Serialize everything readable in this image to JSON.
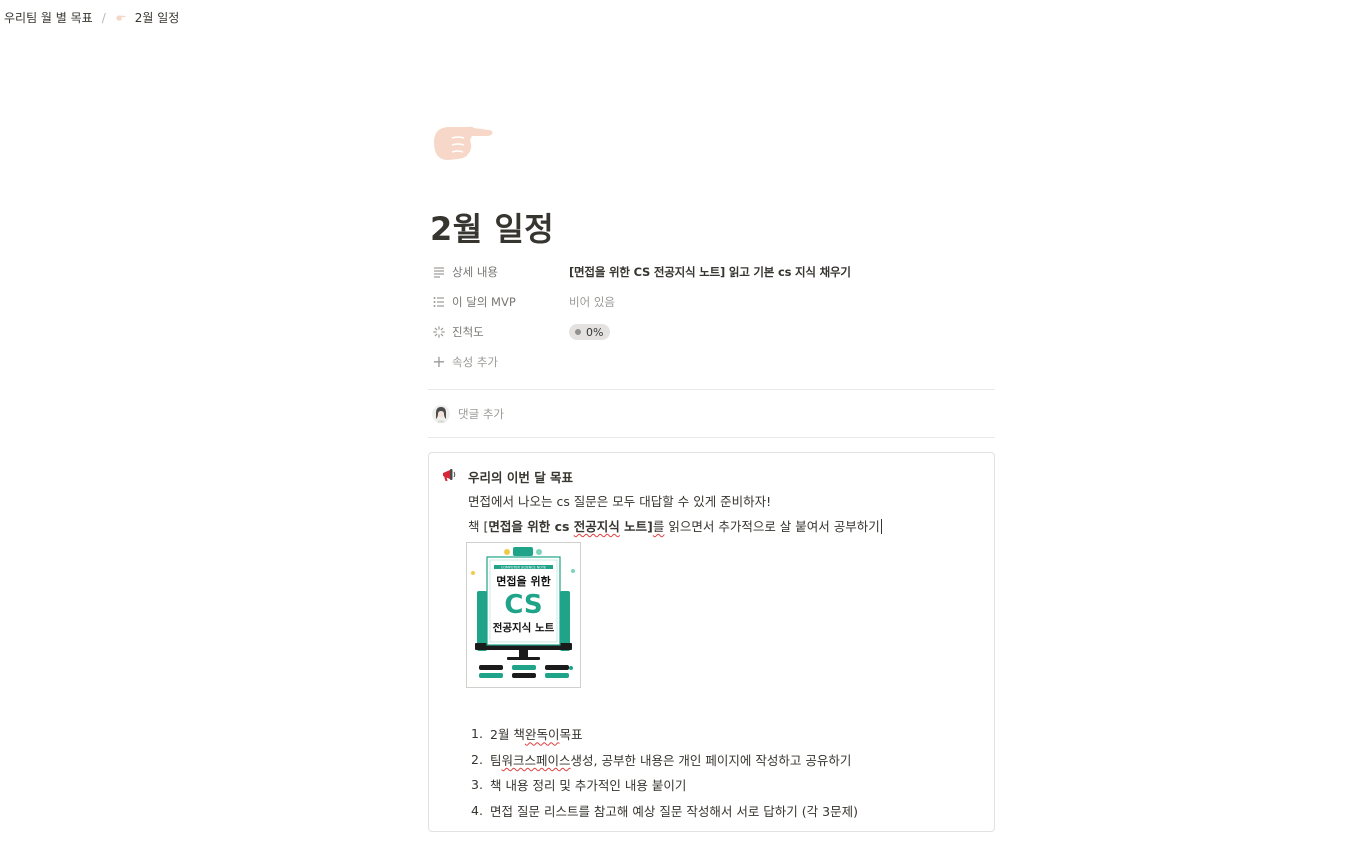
{
  "breadcrumb": {
    "parent": "우리팀 월 별 목표",
    "separator": "/",
    "current": "2월 일정"
  },
  "page": {
    "icon": "backhand-index-pointing-right-emoji",
    "title": "2월 일정"
  },
  "properties": [
    {
      "icon": "text-lines-icon",
      "name": "상세 내용",
      "value": "[면접을 위한 CS 전공지식 노트] 읽고 기본 cs 지식 채우기"
    },
    {
      "icon": "bulleted-list-icon",
      "name": "이 달의 MVP",
      "value": "비어 있음"
    },
    {
      "icon": "status-spinner-icon",
      "name": "진척도",
      "value": "0%"
    }
  ],
  "add_property_label": "속성 추가",
  "comment_placeholder": "댓글 추가",
  "callout": {
    "icon": "megaphone-icon",
    "title": "우리의 이번 달 목표",
    "line1": "면접에서 나오는 cs 질문은 모두 대답할 수 있게 준비하자!",
    "line2_prefix": "책 [",
    "line2_bold_a": "면접을 위한 cs ",
    "line2_bold_squiggle": "전공지식",
    "line2_bold_b": " 노트",
    "line2_suffix_mark": "]",
    "line2_squiggle_b": "를",
    "line2_rest": " 읽으면서 추가적으로 살 붙여서 공부하기",
    "book_cover": {
      "series": "COMPUTER SCIENCE NOTE",
      "title_line1": "면접을 위한",
      "title_line2": "CS",
      "title_line3": "전공지식 노트"
    },
    "goals": [
      {
        "num": "1.",
        "pre": "2월 책 ",
        "squiggle": "완독이",
        "post": " 목표"
      },
      {
        "num": "2.",
        "pre": "팀 ",
        "squiggle": "워크스페이스",
        "post": " 생성, 공부한 내용은 개인 페이지에 작성하고 공유하기"
      },
      {
        "num": "3.",
        "pre": "책 내용 정리 및 추가적인 내용 붙이기",
        "squiggle": "",
        "post": ""
      },
      {
        "num": "4.",
        "pre": "면접 질문 리스트를 참고해 예상 질문 작성해서 서로 답하기 (각 3문제)",
        "squiggle": "",
        "post": ""
      }
    ]
  },
  "colors": {
    "text": "#37352f",
    "muted": "#787774",
    "placeholder": "#9b9a97",
    "divider": "#e9e9e7",
    "status_pill_bg": "#e3e2e0",
    "book_accent": "#1fa389",
    "spellcheck": "#e03e3e"
  }
}
